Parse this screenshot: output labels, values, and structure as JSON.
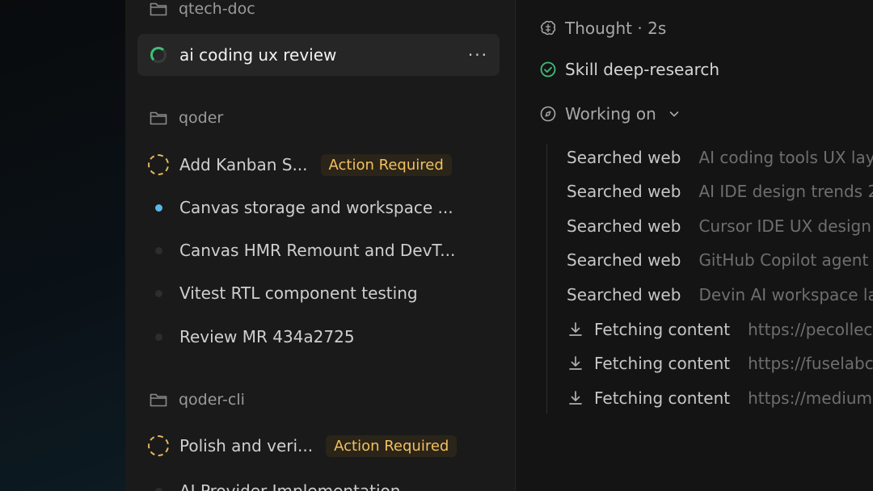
{
  "sidebar": {
    "groups": [
      {
        "name": "qtech-doc"
      },
      {
        "name": "qoder"
      },
      {
        "name": "qoder-cli"
      }
    ],
    "tasks": [
      {
        "label": "ai coding ux review",
        "status": "running",
        "active": true
      },
      {
        "label": "Add Kanban S...",
        "status": "action-required",
        "badge": "Action Required"
      },
      {
        "label": "Canvas storage and workspace ...",
        "status": "unread"
      },
      {
        "label": "Canvas HMR Remount and DevT...",
        "status": "idle"
      },
      {
        "label": "Vitest RTL component testing",
        "status": "idle"
      },
      {
        "label": "Review MR 434a2725",
        "status": "idle"
      },
      {
        "label": "Polish and veri...",
        "status": "action-required",
        "badge": "Action Required"
      },
      {
        "label": "AI Provider Implementation",
        "status": "idle"
      }
    ],
    "more_label": "···"
  },
  "main": {
    "thought": "Thought · 2s",
    "skill": "Skill deep-research",
    "working": "Working on",
    "activities": [
      {
        "kind": "Searched web",
        "detail": "AI coding tools UX lay"
      },
      {
        "kind": "Searched web",
        "detail": "AI IDE design trends 2"
      },
      {
        "kind": "Searched web",
        "detail": "Cursor IDE UX design"
      },
      {
        "kind": "Searched web",
        "detail": "GitHub Copilot agent"
      },
      {
        "kind": "Searched web",
        "detail": "Devin AI workspace la"
      },
      {
        "kind": "Fetching content",
        "detail": "https://pecollec"
      },
      {
        "kind": "Fetching content",
        "detail": "https://fuselabc"
      },
      {
        "kind": "Fetching content",
        "detail": "https://medium"
      }
    ]
  },
  "colors": {
    "badge_text": "#f0c160",
    "badge_bg": "#2b2418",
    "unread_dot": "#5ab8e8",
    "success": "#3fbf7a",
    "pending": "#e2b75a"
  }
}
